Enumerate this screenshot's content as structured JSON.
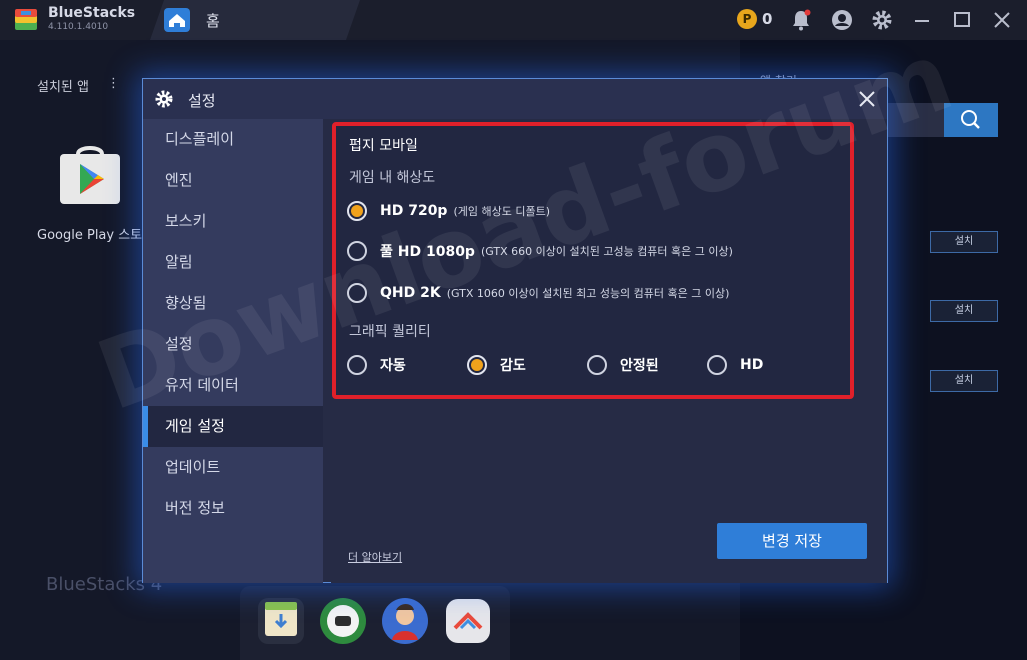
{
  "titlebar": {
    "brand_name": "BlueStacks",
    "brand_version": "4.110.1.4010",
    "tab_label": "홈",
    "coin_symbol": "P",
    "coin_count": "0"
  },
  "background": {
    "installed_apps_title": "설치된 앱",
    "installed_more": "⋮",
    "google_play_label": "Google Play 스토어",
    "app_search_title": "앱 찾기",
    "install_label": "설치",
    "bluestacks_mark": "BlueStacks 4"
  },
  "dialog": {
    "title": "설정",
    "sidebar": [
      {
        "label": "디스플레이",
        "active": false
      },
      {
        "label": "엔진",
        "active": false
      },
      {
        "label": "보스키",
        "active": false
      },
      {
        "label": "알림",
        "active": false
      },
      {
        "label": "향상됨",
        "active": false
      },
      {
        "label": "설정",
        "active": false
      },
      {
        "label": "유저 데이터",
        "active": false
      },
      {
        "label": "게임 설정",
        "active": true
      },
      {
        "label": "업데이트",
        "active": false
      },
      {
        "label": "버전 정보",
        "active": false
      }
    ],
    "game": {
      "name": "펍지 모바일",
      "resolution_title": "게임 내 해상도",
      "resolutions": [
        {
          "label": "HD 720p",
          "note": "(게임 해상도 디폴트)",
          "selected": true
        },
        {
          "label": "풀 HD 1080p",
          "note": "(GTX 660 이상이 설치된 고성능 컴퓨터 혹은 그 이상)",
          "selected": false
        },
        {
          "label": "QHD 2K",
          "note": "(GTX 1060 이상이 설치된 최고 성능의 컴퓨터 혹은 그 이상)",
          "selected": false
        }
      ],
      "quality_title": "그래픽 퀄리티",
      "qualities": [
        {
          "label": "자동",
          "selected": false
        },
        {
          "label": "감도",
          "selected": true
        },
        {
          "label": "안정된",
          "selected": false
        },
        {
          "label": "HD",
          "selected": false
        }
      ]
    },
    "learn_more": "더 알아보기",
    "save_button": "변경 저장"
  },
  "watermark": "Download-forum",
  "colors": {
    "accent_blue": "#2f7ed8",
    "highlight_red": "#e0202a",
    "radio_selected": "#f0a21c",
    "dialog_bg": "#262b45",
    "sidebar_bg": "#343b5e"
  }
}
